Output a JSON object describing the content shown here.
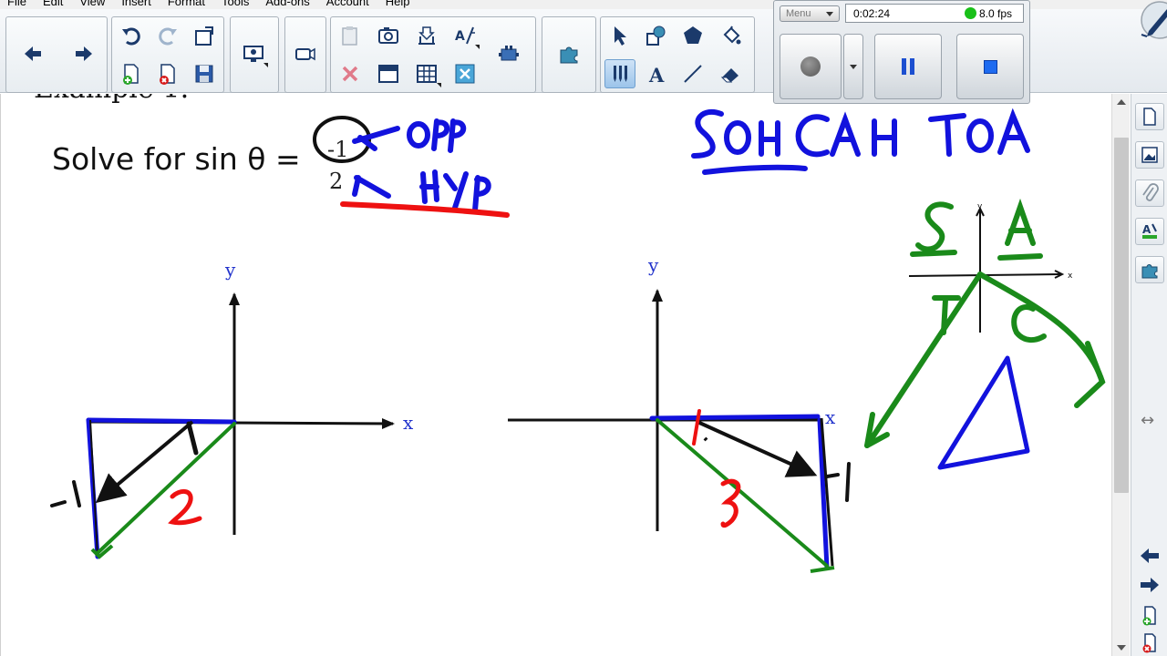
{
  "menu": [
    "File",
    "Edit",
    "View",
    "Insert",
    "Format",
    "Tools",
    "Add-ons",
    "Account",
    "Help"
  ],
  "recorder": {
    "menu_label": "Menu",
    "elapsed": "0:02:24",
    "fps": "8.0 fps",
    "status_color": "#19c019"
  },
  "toolbar": {
    "icons": [
      "back-arrow-icon",
      "forward-arrow-icon",
      "undo-icon",
      "redo-icon",
      "paste-icon",
      "add-page-icon",
      "delete-page-icon",
      "save-icon",
      "screen-share-icon",
      "document-camera-icon",
      "clear-icon",
      "screen-capture-icon",
      "screen-shade-icon",
      "table-icon",
      "handwriting-recognition-icon",
      "measurement-tools-icon",
      "add-ons-icon",
      "select-icon",
      "shapes-icon",
      "polygon-icon",
      "fill-icon",
      "pen-icon",
      "text-icon",
      "line-icon",
      "eraser-icon"
    ],
    "active_tool": "pen"
  },
  "page": {
    "heading_partial": "Example 1:",
    "problem_prefix": "Solve for sin θ =",
    "fraction_numerator": "-1",
    "fraction_denominator": "2",
    "graph_left": {
      "x_label": "x",
      "y_label": "y"
    },
    "graph_right": {
      "x_label": "x",
      "y_label": "y"
    },
    "ink_annotations": [
      "opp",
      "Hyp",
      "SOH CAH TOA",
      "S",
      "A",
      "T",
      "C",
      "-1",
      "2",
      "-1",
      "2"
    ],
    "ink_colors": {
      "blue": "#1212dd",
      "red": "#ee1111",
      "green": "#1a8a1a",
      "black": "#111111"
    }
  },
  "side_tabs": [
    "page-sorter-icon",
    "gallery-icon",
    "attachments-icon",
    "properties-icon",
    "add-ons-icon"
  ]
}
